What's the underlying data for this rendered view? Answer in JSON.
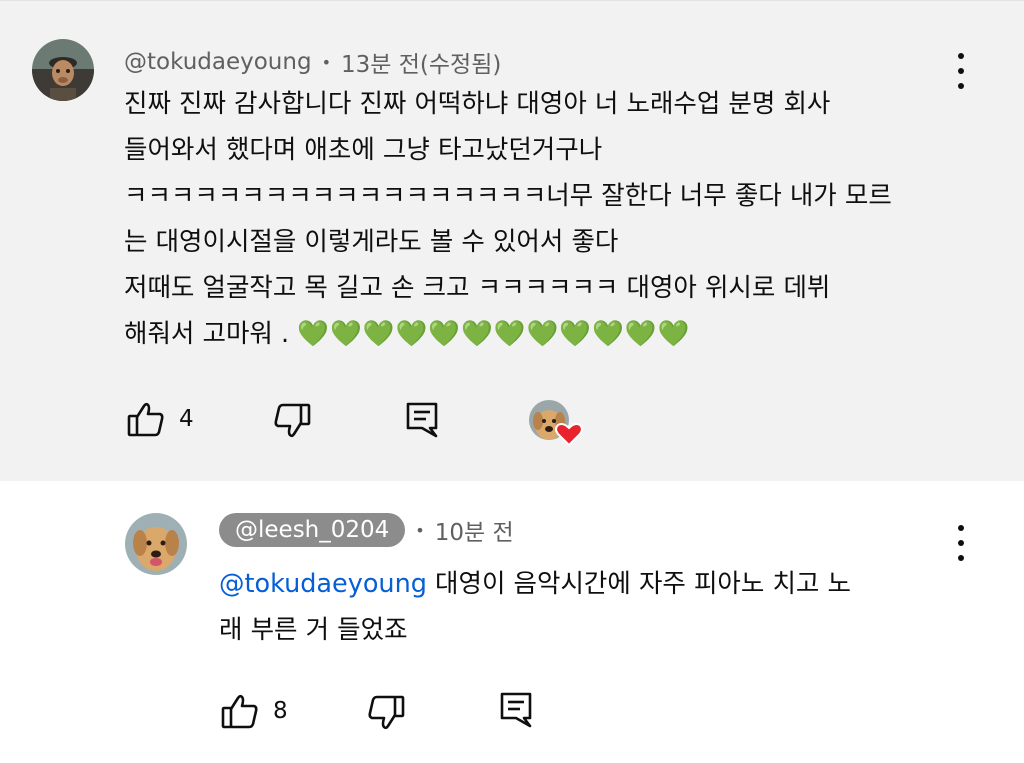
{
  "comment1": {
    "handle": "@tokudaeyoung",
    "time": "13분 전(수정됨)",
    "lines": [
      "진짜 진짜 감사합니다 진짜 어떡하냐 대영아 너 노래수업 분명 회사",
      "들어와서 했다며 애초에 그냥 타고났던거구나",
      "ㅋㅋㅋㅋㅋㅋㅋㅋㅋㅋㅋㅋㅋㅋㅋㅋㅋㅋ너무 잘한다 너무 좋다 내가 모르",
      "는 대영이시절을 이렇게라도 볼 수 있어서 좋다",
      "저때도 얼굴작고 목 길고 손 크고 ㅋㅋㅋㅋㅋㅋ 대영아 위시로 데뷔",
      "해줘서 고마워 ."
    ],
    "hearts": "💚💚💚💚💚💚💚💚💚💚💚💚",
    "like_count": "4",
    "icons": {
      "like": "thumbs-up-icon",
      "dislike": "thumbs-down-icon",
      "reply": "reply-icon",
      "creator_heart": "creator-heart-icon"
    }
  },
  "comment2": {
    "handle": "@leesh_0204",
    "time": "10분 전",
    "mention": "@tokudaeyoung",
    "line1_rest": " 대영이 음악시간에 자주 피아노 치고 노",
    "line2": "래 부른 거 들었죠",
    "like_count": "8"
  },
  "colors": {
    "background_top": "#f2f2f2",
    "mention_blue": "#065fd4",
    "meta_gray": "#606060",
    "pill_gray": "#8c8c8c",
    "heart_red": "#e8232b",
    "heart_green": "#2fb830"
  }
}
